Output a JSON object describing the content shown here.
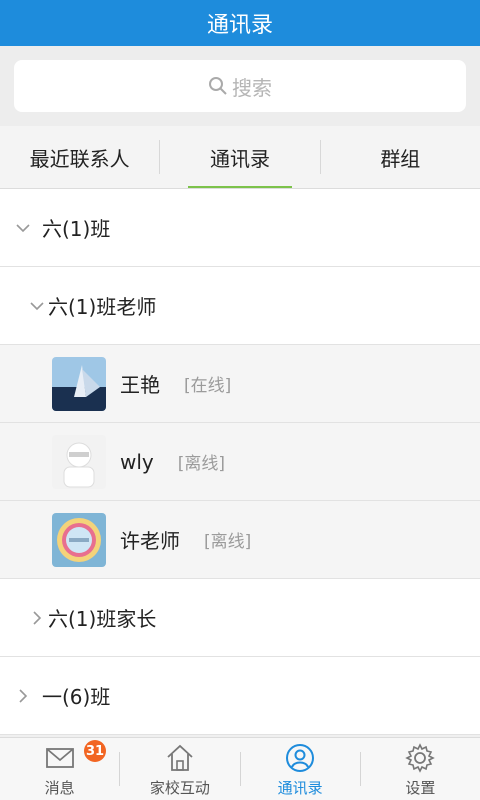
{
  "header": {
    "title": "通讯录"
  },
  "search": {
    "placeholder": "搜索"
  },
  "tabs": [
    {
      "label": "最近联系人",
      "active": false
    },
    {
      "label": "通讯录",
      "active": true
    },
    {
      "label": "群组",
      "active": false
    }
  ],
  "groups": {
    "class_6_1": {
      "label": "六(1)班",
      "expanded": true
    },
    "teachers": {
      "label": "六(1)班老师",
      "expanded": true
    },
    "parents": {
      "label": "六(1)班家长",
      "expanded": false
    },
    "class_1_6": {
      "label": "一(6)班",
      "expanded": false
    }
  },
  "contacts": [
    {
      "name": "王艳",
      "status": "[在线]"
    },
    {
      "name": "wly",
      "status": "[离线]"
    },
    {
      "name": "许老师",
      "status": "[离线]"
    }
  ],
  "nav": {
    "items": [
      {
        "label": "消息",
        "icon": "mail-icon",
        "badge": "31"
      },
      {
        "label": "家校互动",
        "icon": "home-icon"
      },
      {
        "label": "通讯录",
        "icon": "contacts-icon",
        "active": true
      },
      {
        "label": "设置",
        "icon": "gear-icon"
      }
    ]
  },
  "colors": {
    "header": "#1e8cdc",
    "tab_underline": "#7cc24a",
    "badge": "#f26522"
  }
}
